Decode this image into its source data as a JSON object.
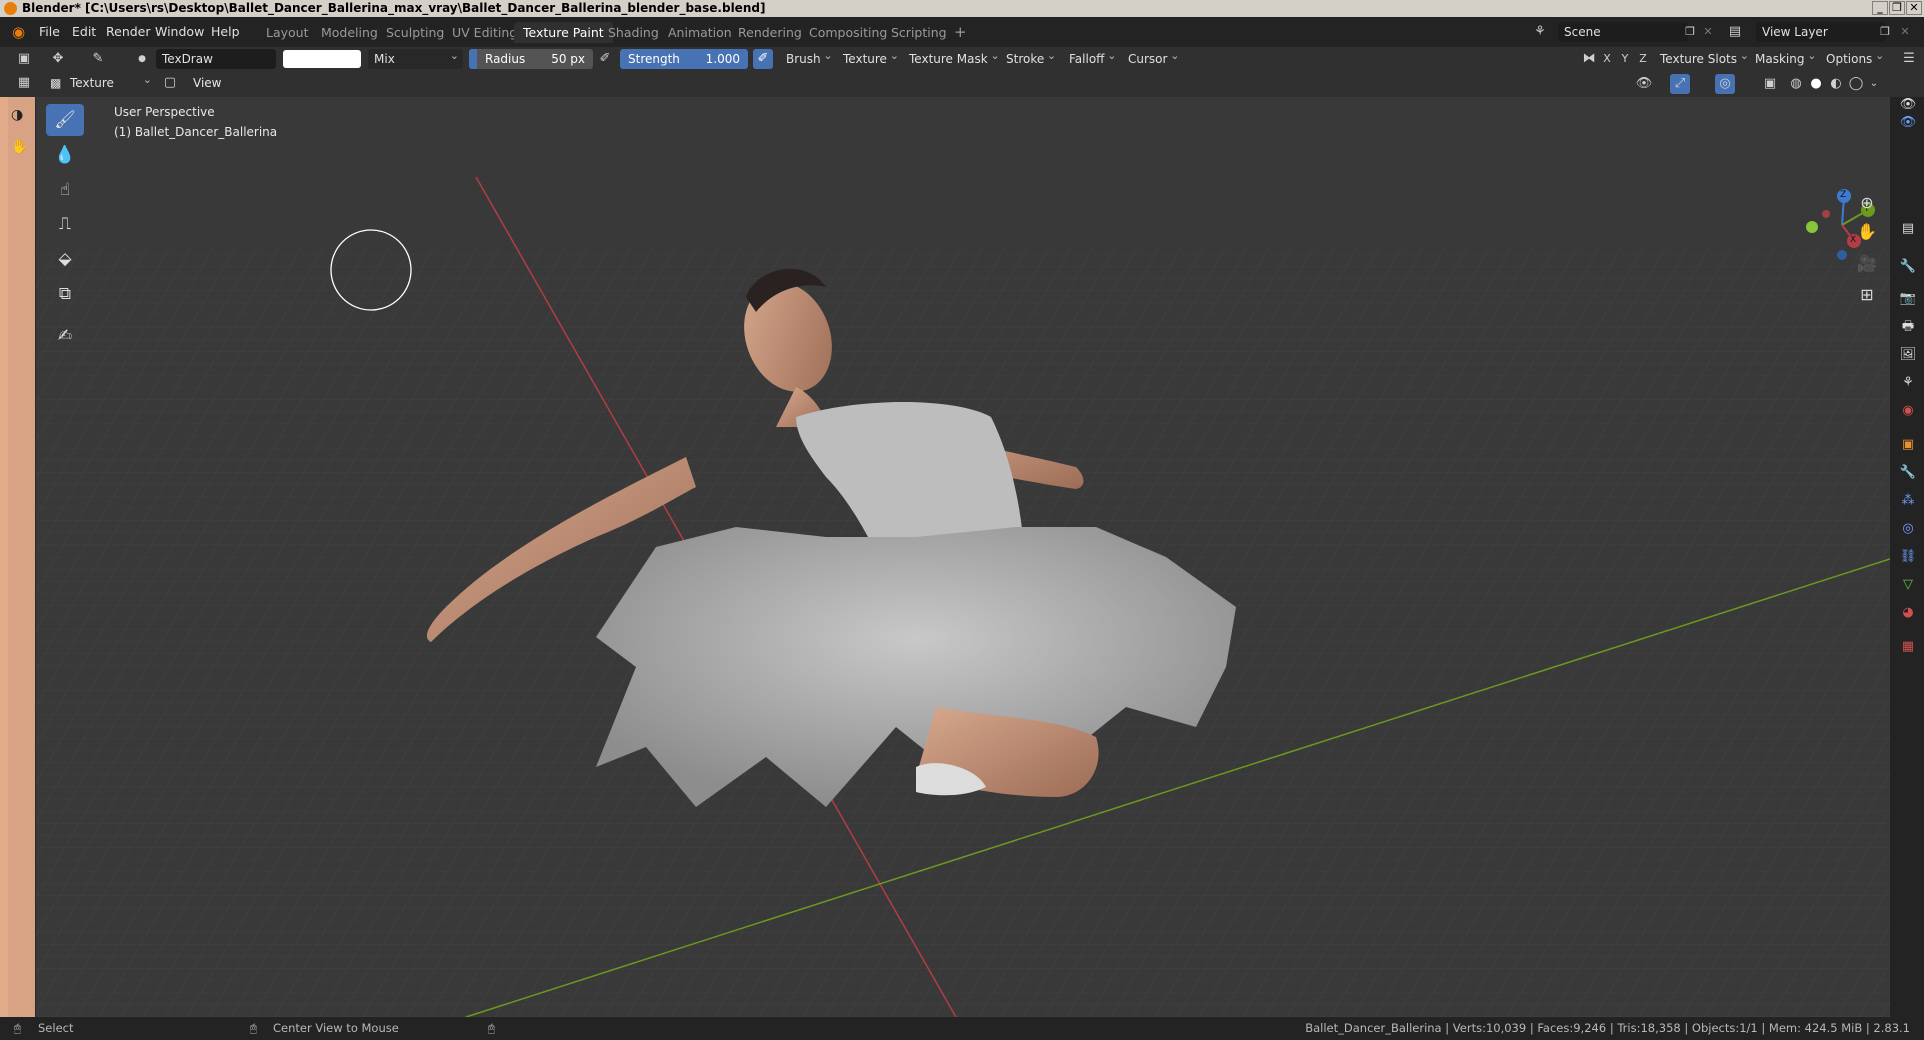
{
  "window": {
    "title": "Blender* [C:\\Users\\rs\\Desktop\\Ballet_Dancer_Ballerina_max_vray\\Ballet_Dancer_Ballerina_blender_base.blend]",
    "min": "_",
    "max": "❐",
    "close": "✕"
  },
  "menu": [
    "File",
    "Edit",
    "Render",
    "Window",
    "Help"
  ],
  "workspaces": [
    {
      "label": "Layout"
    },
    {
      "label": "Modeling"
    },
    {
      "label": "Sculpting"
    },
    {
      "label": "UV Editing"
    },
    {
      "label": "Texture Paint",
      "active": true
    },
    {
      "label": "Shading"
    },
    {
      "label": "Animation"
    },
    {
      "label": "Rendering"
    },
    {
      "label": "Compositing"
    },
    {
      "label": "Scripting"
    }
  ],
  "add_workspace": "+",
  "scene": {
    "label": "Scene",
    "view_layer": "View Layer"
  },
  "tool_header": {
    "brush_name": "TexDraw",
    "blend_mode": "Mix",
    "radius_label": "Radius",
    "radius_value": "50 px",
    "strength_label": "Strength",
    "strength_value": "1.000",
    "menus": [
      "Brush",
      "Texture",
      "Texture Mask",
      "Stroke",
      "Falloff",
      "Cursor"
    ],
    "axes": [
      "X",
      "Y",
      "Z"
    ],
    "right_menus": [
      "Texture Slots",
      "Masking",
      "Options"
    ]
  },
  "viewport_header": {
    "mode": "Texture Paint",
    "view": "View"
  },
  "viewport": {
    "perspective": "User Perspective",
    "object": "(1) Ballet_Dancer_Ballerina",
    "gizmo_axes": {
      "z": "Z",
      "y": "Y",
      "x": "X"
    },
    "colors": {
      "x_axis": "#b33c45",
      "y_axis": "#6a9a1f",
      "z_axis": "#3d7ad0"
    }
  },
  "status": {
    "select": "Select",
    "center": "Center View to Mouse",
    "info": "Ballet_Dancer_Ballerina | Verts:10,039 | Faces:9,246 | Tris:18,358 | Objects:1/1 | Mem: 424.5 MiB | 2.83.1"
  },
  "colors": {
    "accent": "#4772b3",
    "active_tab": "#303030",
    "header_bg": "#232323"
  }
}
